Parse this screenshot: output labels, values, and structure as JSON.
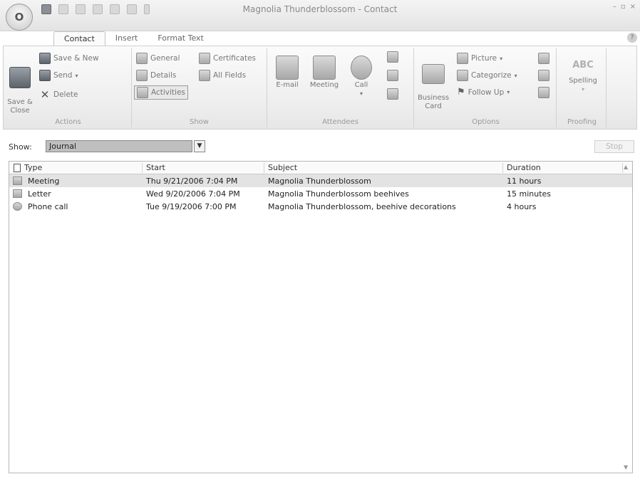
{
  "window": {
    "title": "Magnolia Thunderblossom - Contact",
    "office_button": "O"
  },
  "tabs": [
    {
      "label": "Contact",
      "active": true
    },
    {
      "label": "Insert",
      "active": false
    },
    {
      "label": "Format Text",
      "active": false
    }
  ],
  "ribbon": {
    "actions": {
      "label": "Actions",
      "save_close": "Save &\nClose",
      "save_new": "Save & New",
      "send": "Send",
      "delete": "Delete"
    },
    "show": {
      "label": "Show",
      "general": "General",
      "details": "Details",
      "activities": "Activities",
      "certificates": "Certificates",
      "all_fields": "All Fields"
    },
    "attendees": {
      "label": "Attendees",
      "email": "E-mail",
      "meeting": "Meeting",
      "call": "Call"
    },
    "options": {
      "label": "Options",
      "business_card": "Business\nCard",
      "picture": "Picture",
      "categorize": "Categorize",
      "follow_up": "Follow Up"
    },
    "proofing": {
      "label": "Proofing",
      "abc": "ABC",
      "spelling": "Spelling"
    }
  },
  "showbar": {
    "label": "Show:",
    "selected": "Journal",
    "stop": "Stop"
  },
  "list": {
    "headers": {
      "type": "Type",
      "start": "Start",
      "subject": "Subject",
      "duration": "Duration"
    },
    "rows": [
      {
        "type": "Meeting",
        "start": "Thu 9/21/2006 7:04 PM",
        "subject": "Magnolia Thunderblossom",
        "duration": "11 hours",
        "icon": "meeting-icon"
      },
      {
        "type": "Letter",
        "start": "Wed 9/20/2006 7:04 PM",
        "subject": "Magnolia Thunderblossom beehives",
        "duration": "15 minutes",
        "icon": "letter-icon"
      },
      {
        "type": "Phone call",
        "start": "Tue 9/19/2006 7:00 PM",
        "subject": "Magnolia Thunderblossom, beehive decorations",
        "duration": "4 hours",
        "icon": "phone-call-icon"
      }
    ]
  }
}
